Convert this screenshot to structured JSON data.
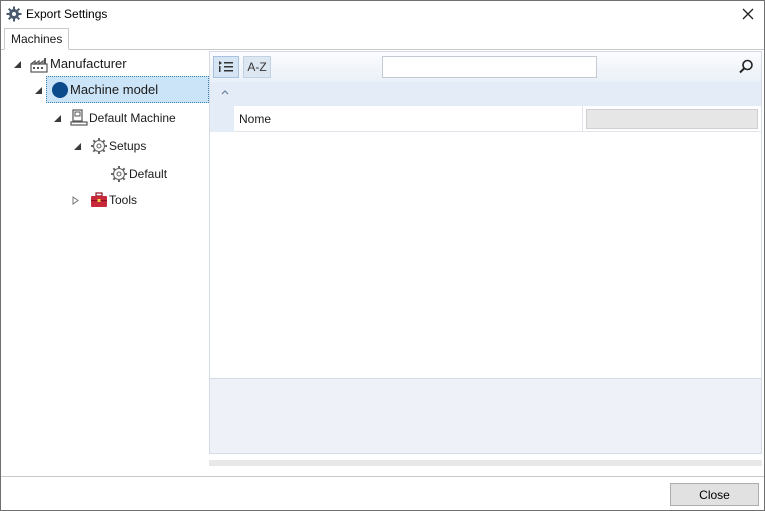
{
  "window": {
    "title": "Export Settings"
  },
  "tabs": [
    {
      "label": "Machines"
    }
  ],
  "tree": {
    "manufacturer": {
      "label": "Manufacturer"
    },
    "machine_model": {
      "label": "Machine model"
    },
    "default_machine": {
      "label": "Default Machine"
    },
    "setups": {
      "label": "Setups"
    },
    "default_setup": {
      "label": "Default"
    },
    "tools": {
      "label": "Tools"
    }
  },
  "property_grid": {
    "az_label": "A-Z",
    "search": {
      "value": "",
      "placeholder": ""
    },
    "properties": [
      {
        "name": "Nome",
        "value": ""
      }
    ]
  },
  "footer": {
    "close_label": "Close"
  },
  "colors": {
    "selection": "#cce4f7",
    "machine_model_icon": "#0b4a8b",
    "tools_icon": "#c8283c"
  }
}
